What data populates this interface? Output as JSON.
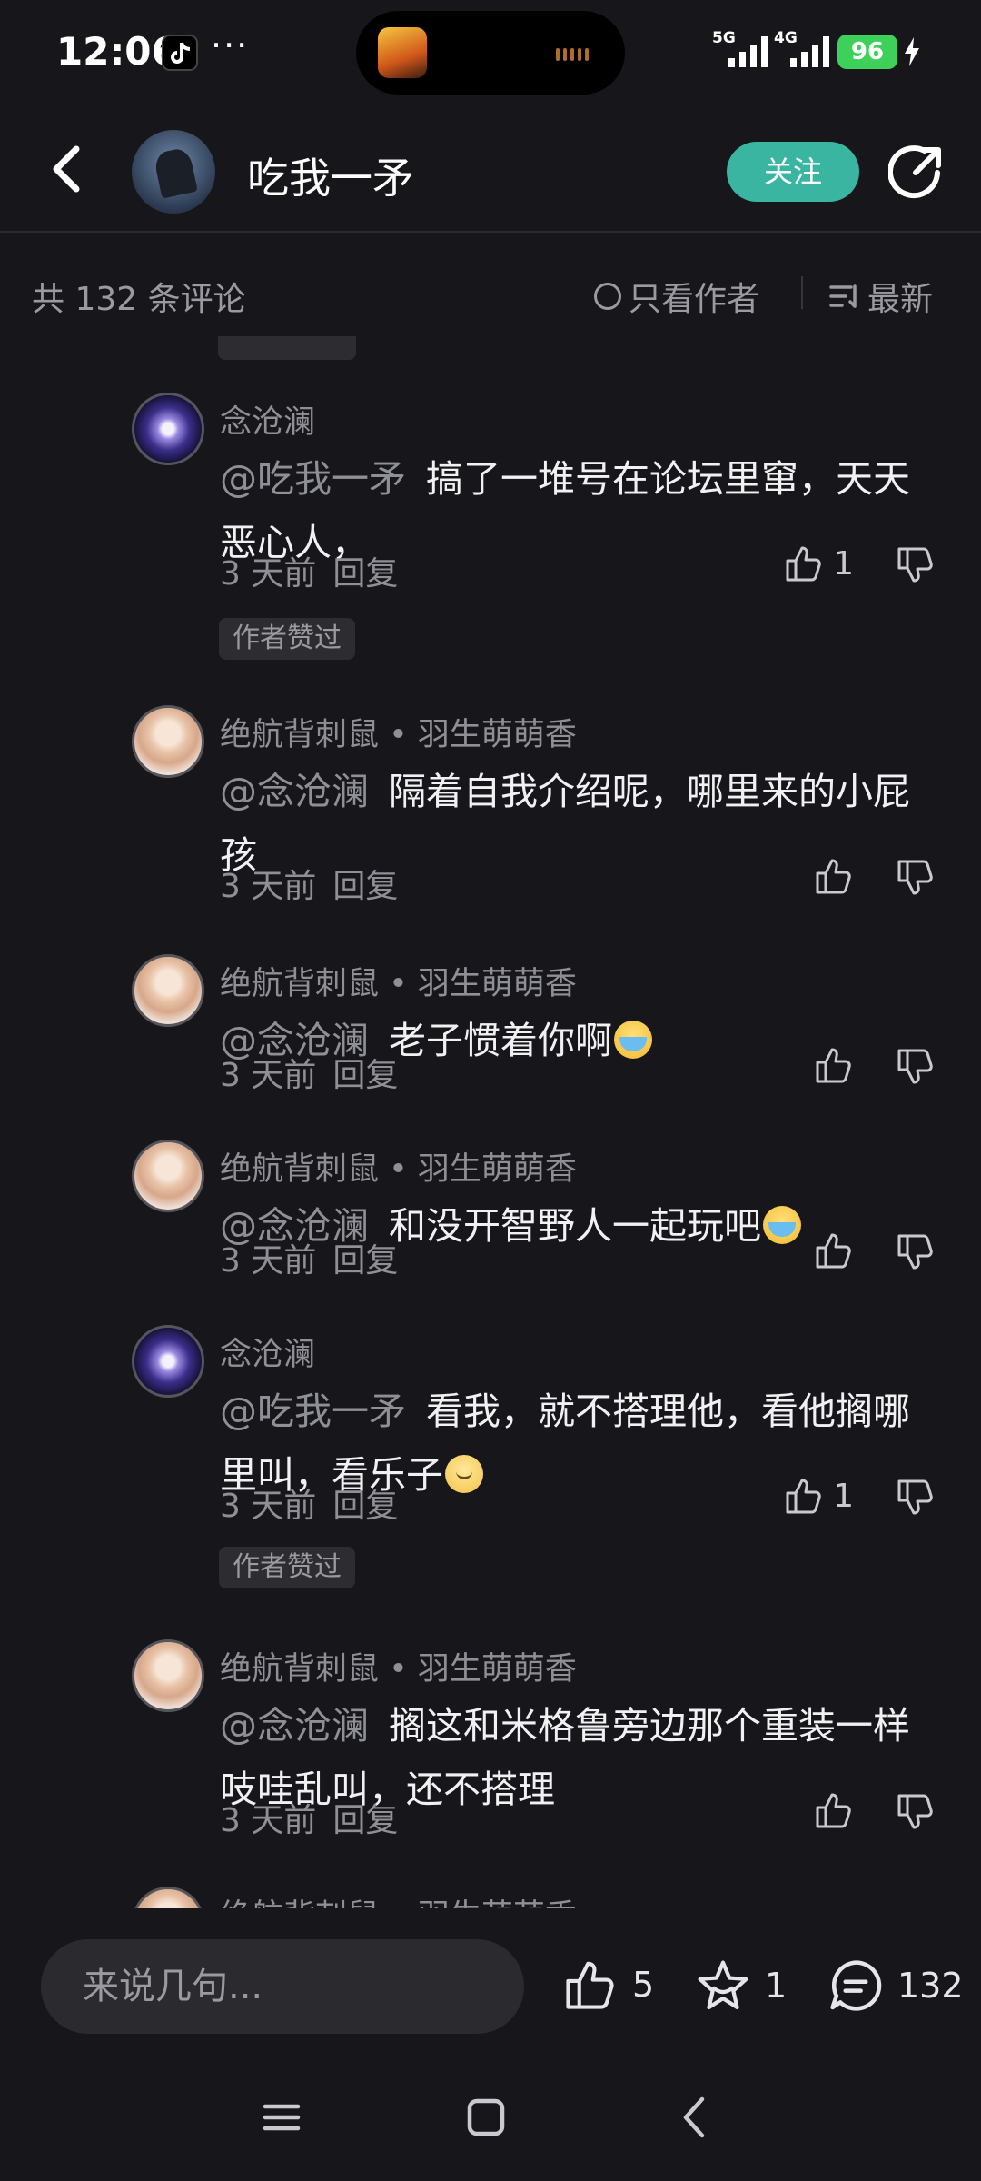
{
  "status_bar": {
    "time": "12:06",
    "more": "···",
    "signal_1": "5G",
    "signal_2": "4G",
    "battery": "96"
  },
  "header": {
    "title": "吃我一矛",
    "follow_label": "关注"
  },
  "filter": {
    "count": "共 132 条评论",
    "author_only": "只看作者",
    "sort": "最新"
  },
  "comments": [
    {
      "user": "念沧澜",
      "mention": "@吃我一矛",
      "text": "搞了一堆号在论坛里窜，天天恶心人，",
      "time": "3 天前",
      "reply": "回复",
      "likes": "1",
      "badge": "作者赞过"
    },
    {
      "user": "绝航背刺鼠 • 羽生萌萌香",
      "mention": "@念沧澜",
      "text": "隔着自我介绍呢，哪里来的小屁孩",
      "time": "3 天前",
      "reply": "回复",
      "likes": ""
    },
    {
      "user": "绝航背刺鼠 • 羽生萌萌香",
      "mention": "@念沧澜",
      "text": "老子惯着你啊",
      "time": "3 天前",
      "reply": "回复",
      "likes": ""
    },
    {
      "user": "绝航背刺鼠 • 羽生萌萌香",
      "mention": "@念沧澜",
      "text": "和没开智野人一起玩吧",
      "time": "3 天前",
      "reply": "回复",
      "likes": ""
    },
    {
      "user": "念沧澜",
      "mention": "@吃我一矛",
      "text": "看我，就不搭理他，看他搁哪里叫，看乐子",
      "time": "3 天前",
      "reply": "回复",
      "likes": "1",
      "badge": "作者赞过"
    },
    {
      "user": "绝航背刺鼠 • 羽生萌萌香",
      "mention": "@念沧澜",
      "text": "搁这和米格鲁旁边那个重装一样吱哇乱叫，还不搭理",
      "time": "3 天前",
      "reply": "回复",
      "likes": ""
    },
    {
      "user": "绝航背刺鼠 • 羽生萌萌香"
    }
  ],
  "bottom": {
    "input_placeholder": "来说几句...",
    "likes": "5",
    "favorites": "1",
    "comments": "132"
  },
  "colors": {
    "background": "#17171b",
    "accent": "#3ab5a1",
    "battery": "#3dd15a"
  }
}
